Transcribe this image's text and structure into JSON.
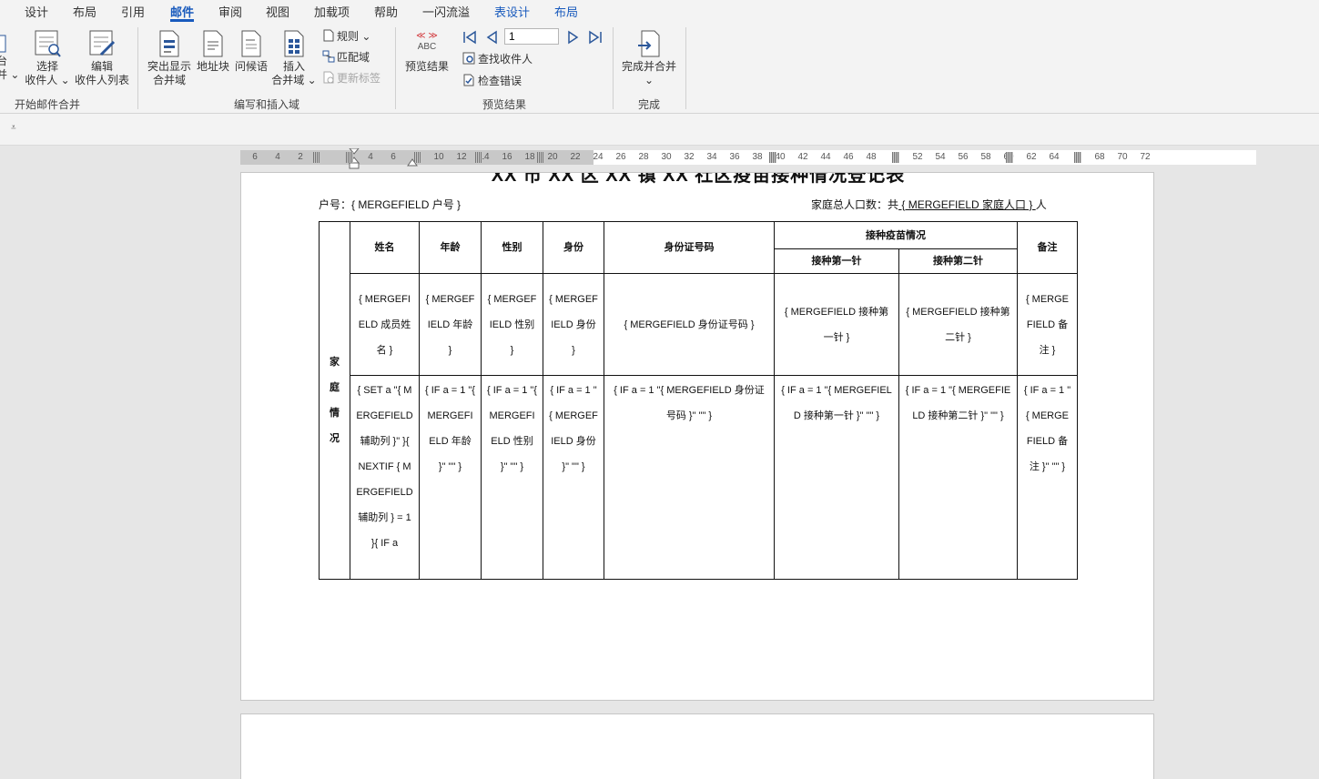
{
  "tabs": [
    "设计",
    "布局",
    "引用",
    "邮件",
    "审阅",
    "视图",
    "加载项",
    "帮助",
    "一闪流溢",
    "表设计",
    "布局"
  ],
  "active_tab": "邮件",
  "ribbon": {
    "start_group": {
      "partial_top": "台",
      "partial_bottom": "并 ⌄",
      "select_recipients": [
        "选择",
        "收件人 ⌄"
      ],
      "edit_list": [
        "编辑",
        "收件人列表"
      ],
      "label": "开始邮件合并"
    },
    "write_group": {
      "highlight": [
        "突出显示",
        "合并域"
      ],
      "address_block": "地址块",
      "greeting": "问候语",
      "insert_field": [
        "插入",
        "合并域 ⌄"
      ],
      "rules": "规则 ⌄",
      "match_fields": "匹配域",
      "update_labels": "更新标签",
      "label": "编写和插入域"
    },
    "preview_group": {
      "preview_results": "预览结果",
      "abc_glyph": "≪ ≫ ABC",
      "record_number": "1",
      "find_recipient": "查找收件人",
      "check_errors": "检查错误",
      "label": "预览结果"
    },
    "finish_group": {
      "finish_merge": "完成并合并",
      "finish_caret": "⌄",
      "label": "完成"
    }
  },
  "qat": {
    "customize": "⩡"
  },
  "ruler": {
    "labels": [
      "6",
      "4",
      "2",
      "4",
      "6",
      "10",
      "12",
      "14",
      "16",
      "18",
      "20",
      "22",
      "24",
      "26",
      "28",
      "30",
      "32",
      "34",
      "36",
      "38",
      "40",
      "42",
      "44",
      "46",
      "48",
      "52",
      "54",
      "56",
      "58",
      "60",
      "62",
      "64",
      "68",
      "70",
      "72"
    ]
  },
  "document": {
    "title": "XX 市 XX 区 XX 镇 XX 社区疫苗接种情况登记表",
    "household_label": "户号：",
    "household_field": "{ MERGEFIELD 户号 }",
    "total_label": "家庭总人口数：共",
    "total_field": " { MERGEFIELD 家庭人口 } ",
    "total_unit": "人",
    "table": {
      "side_label": "家庭情况",
      "headers": {
        "name": "姓名",
        "age": "年龄",
        "gender": "性别",
        "identity": "身份",
        "id_number": "身份证号码",
        "vaccine_group": "接种疫苗情况",
        "first_dose": "接种第一针",
        "second_dose": "接种第二针",
        "remark": "备注"
      },
      "row1": [
        "{ MERGEFIELD 成员姓名 }",
        "{ MERGEFIELD 年龄 }",
        "{ MERGEFIELD 性别 }",
        "{ MERGEFIELD 身份 }",
        "{ MERGEFIELD 身份证号码 }",
        "{ MERGEFIELD 接种第一针 }",
        "{ MERGEFIELD 接种第二针 }",
        "{ MERGEFIELD 备注 }"
      ],
      "row2": [
        "{ SET a \"{ MERGEFIELD 辅助列 }\" }{ NEXTIF { MERGEFIELD 辅助列 } = 1 }{ IF a",
        "{ IF a = 1 \"{ MERGEFIELD 年龄 }\" \"\" }",
        "{ IF a = 1 \"{ MERGEFIELD 性别 }\" \"\" }",
        "{ IF a = 1 \"{ MERGEFIELD 身份 }\" \"\" }",
        "{ IF a = 1 \"{ MERGEFIELD 身份证号码 }\" \"\" }",
        "{ IF a = 1 \"{ MERGEFIELD 接种第一针 }\" \"\" }",
        "{ IF a = 1 \"{ MERGEFIELD 接种第二针 }\" \"\" }",
        "{ IF a = 1 \"{ MERGEFIELD 备注 }\" \"\" }"
      ]
    }
  },
  "colors": {
    "accent": "#185abd",
    "icon_blue": "#2b579a",
    "icon_red": "#d13438"
  }
}
